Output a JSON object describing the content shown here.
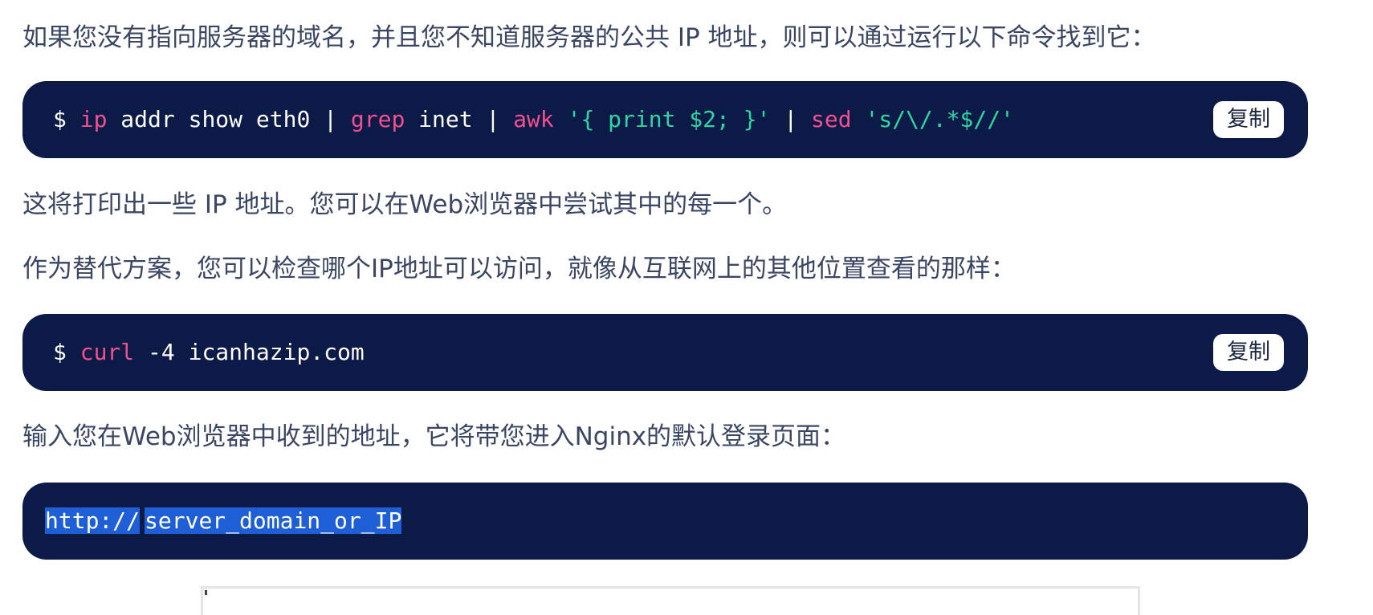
{
  "paragraphs": {
    "p1": "如果您没有指向服务器的域名，并且您不知道服务器的公共 IP 地址，则可以通过运行以下命令找到它：",
    "p2": "这将打印出一些 IP 地址。您可以在Web浏览器中尝试其中的每一个。",
    "p3": "作为替代方案，您可以检查哪个IP地址可以访问，就像从互联网上的其他位置查看的那样：",
    "p4": "输入您在Web浏览器中收到的地址，它将带您进入Nginx的默认登录页面："
  },
  "code1": {
    "prompt": "$",
    "ip": "ip",
    "args1": " addr show eth0 | ",
    "grep": "grep",
    "args2": " inet | ",
    "awk": "awk",
    "str1": " '{ print $2; }'",
    "pipe": " | ",
    "sed": "sed",
    "str2": " 's/\\/.*$//'",
    "copy_label": "复制"
  },
  "code2": {
    "prompt": "$",
    "curl": "curl",
    "args": " -4 icanhazip.com",
    "copy_label": "复制"
  },
  "code3": {
    "part1": "http://",
    "part2": "server_domain_or_IP"
  },
  "colors": {
    "code_bg": "#0b1a47",
    "command": "#f2508f",
    "string": "#2fd6a3",
    "selection": "#1f5fd6",
    "body_text": "#3a4663"
  }
}
